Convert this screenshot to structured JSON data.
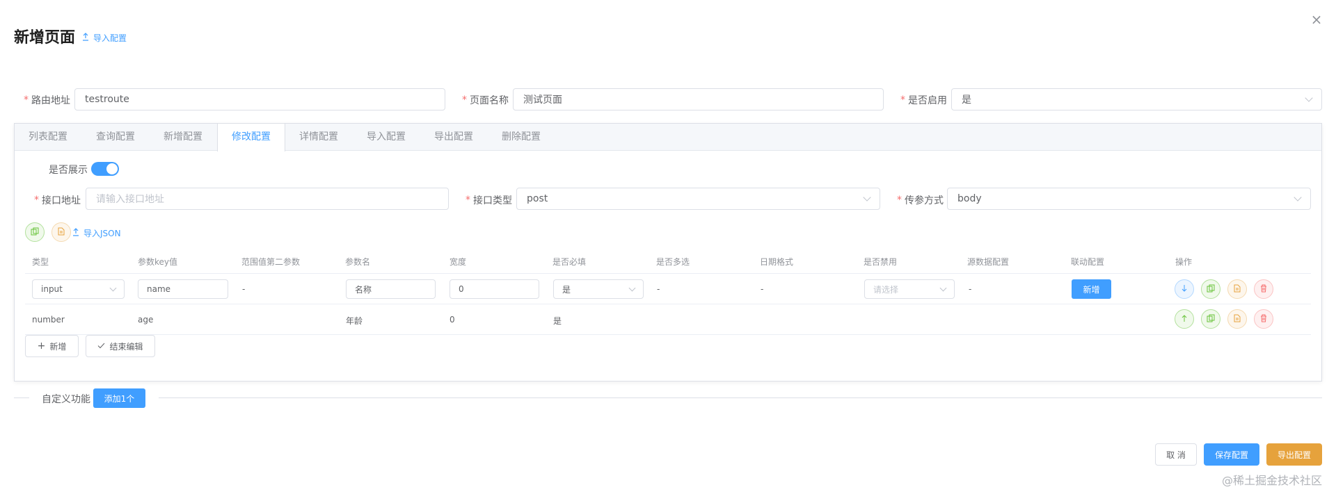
{
  "dialog": {
    "title": "新增页面",
    "import_link": "导入配置",
    "close_glyph": "×"
  },
  "form": {
    "route": {
      "label": "路由地址",
      "value": "testroute"
    },
    "page_name": {
      "label": "页面名称",
      "value": "测试页面"
    },
    "enabled": {
      "label": "是否启用",
      "value": "是"
    }
  },
  "tabs": [
    {
      "label": "列表配置",
      "active": false
    },
    {
      "label": "查询配置",
      "active": false
    },
    {
      "label": "新增配置",
      "active": false
    },
    {
      "label": "修改配置",
      "active": true
    },
    {
      "label": "详情配置",
      "active": false
    },
    {
      "label": "导入配置",
      "active": false
    },
    {
      "label": "导出配置",
      "active": false
    },
    {
      "label": "删除配置",
      "active": false
    }
  ],
  "edit_config": {
    "show": {
      "label": "是否展示",
      "on": true
    },
    "api_url": {
      "label": "接口地址",
      "placeholder": "请输入接口地址"
    },
    "api_type": {
      "label": "接口类型",
      "value": "post"
    },
    "param_mode": {
      "label": "传参方式",
      "value": "body"
    },
    "import_json": "导入JSON"
  },
  "table": {
    "headers": [
      "类型",
      "参数key值",
      "范围值第二参数",
      "参数名",
      "宽度",
      "是否必填",
      "是否多选",
      "日期格式",
      "是否禁用",
      "源数据配置",
      "联动配置",
      "操作"
    ],
    "row1": {
      "type": "input",
      "key": "name",
      "range_second": "-",
      "name": "名称",
      "width": "0",
      "required": "是",
      "multiple": "-",
      "date_format": "-",
      "disabled_placeholder": "请选择",
      "source": "-",
      "link_button": "新增"
    },
    "row2": {
      "type": "number",
      "key": "age",
      "name": "年龄",
      "width": "0",
      "required": "是"
    },
    "add_button": "新增",
    "finish_button": "结束编辑"
  },
  "custom": {
    "label": "自定义功能",
    "add_button": "添加1个"
  },
  "footer": {
    "cancel": "取 消",
    "save": "保存配置",
    "export": "导出配置"
  },
  "watermark": "@稀土掘金技术社区",
  "colors": {
    "primary": "#409eff",
    "warning": "#e6a23c",
    "success": "#67c23a",
    "danger": "#f56c6c"
  }
}
